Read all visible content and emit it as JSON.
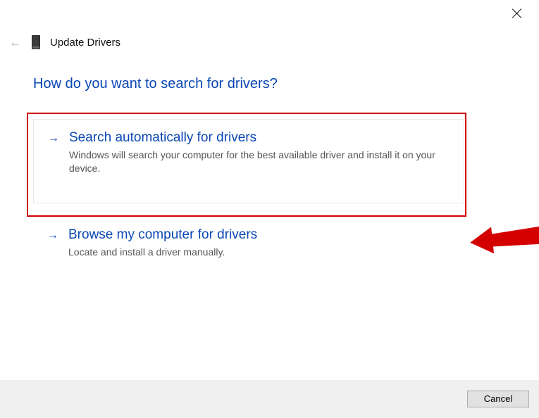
{
  "window": {
    "title": "Update Drivers"
  },
  "question": "How do you want to search for drivers?",
  "options": {
    "auto": {
      "title": "Search automatically for drivers",
      "desc": "Windows will search your computer for the best available driver and install it on your device."
    },
    "browse": {
      "title": "Browse my computer for drivers",
      "desc": "Locate and install a driver manually."
    }
  },
  "buttons": {
    "cancel": "Cancel"
  }
}
